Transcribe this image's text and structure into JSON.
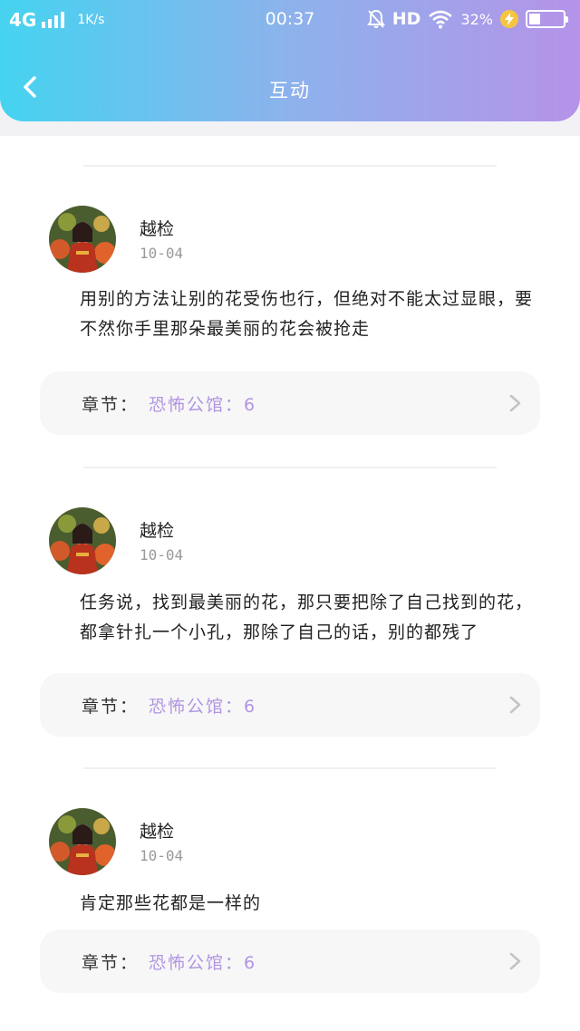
{
  "status_bar": {
    "network": "4G",
    "speed": "1K/s",
    "time": "00:37",
    "hd": "HD",
    "battery_percent": "32%",
    "battery_level": 0.32
  },
  "nav": {
    "title": "互动"
  },
  "colors": {
    "gradient_start": "#45d3f0",
    "gradient_end": "#b593e8",
    "accent": "#b195e0"
  },
  "comments": [
    {
      "username": "越检",
      "date": "10-04",
      "text": "用别的方法让别的花受伤也行，但绝对不能太过显眼，要不然你手里那朵最美丽的花会被抢走",
      "chapter_label": "章节：",
      "chapter_value": "恐怖公馆：6"
    },
    {
      "username": "越检",
      "date": "10-04",
      "text": "任务说，找到最美丽的花，那只要把除了自己找到的花，都拿针扎一个小孔，那除了自己的话，别的都残了",
      "chapter_label": "章节：",
      "chapter_value": "恐怖公馆：6"
    },
    {
      "username": "越检",
      "date": "10-04",
      "text": "肯定那些花都是一样的",
      "chapter_label": "章节：",
      "chapter_value": "恐怖公馆：6"
    }
  ]
}
